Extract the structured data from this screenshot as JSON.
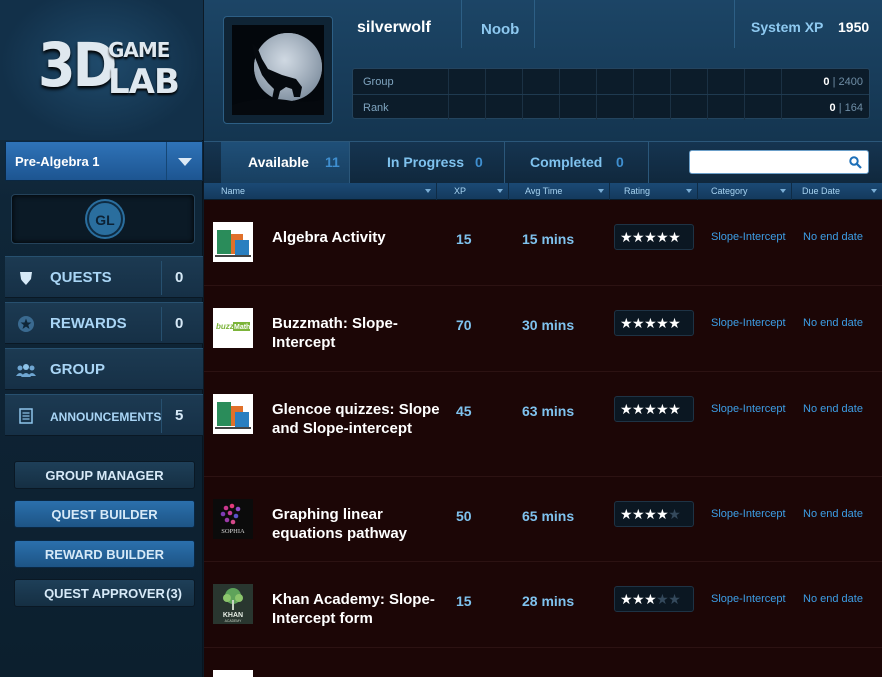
{
  "logo": {
    "big": "3D",
    "top": "GAME",
    "bottom": "LAB"
  },
  "course": {
    "selected": "Pre-Algebra 1"
  },
  "badge": {
    "initials": "GL"
  },
  "sidebar": {
    "items": [
      {
        "label": "QUESTS",
        "count": "0",
        "icon": "shield-icon"
      },
      {
        "label": "REWARDS",
        "count": "0",
        "icon": "star-badge-icon"
      },
      {
        "label": "GROUP",
        "count": "",
        "icon": "group-icon"
      },
      {
        "label": "ANNOUNCEMENTS",
        "count": "5",
        "icon": "document-icon"
      }
    ],
    "buttons": [
      {
        "label": "GROUP MANAGER",
        "badge": ""
      },
      {
        "label": "QUEST BUILDER",
        "badge": ""
      },
      {
        "label": "REWARD BUILDER",
        "badge": ""
      },
      {
        "label": "QUEST APPROVER",
        "badge": "(3)"
      }
    ]
  },
  "profile": {
    "username": "silverwolf",
    "level": "Noob",
    "system_xp_label": "System XP",
    "system_xp": "1950",
    "group_label": "Group",
    "group_value": "0",
    "group_total": "2400",
    "rank_label": "Rank",
    "rank_value": "0",
    "rank_total": "164"
  },
  "tabs": [
    {
      "label": "Available",
      "count": "11"
    },
    {
      "label": "In Progress",
      "count": "0"
    },
    {
      "label": "Completed",
      "count": "0"
    }
  ],
  "search": {
    "placeholder": "",
    "value": ""
  },
  "columns": [
    "Name",
    "XP",
    "Avg Time",
    "Rating",
    "Category",
    "Due Date"
  ],
  "quests": [
    {
      "name": "Algebra Activity",
      "xp": "15",
      "avg_time": "15 mins",
      "rating": 5,
      "category": "Slope-Intercept",
      "due": "No end date",
      "thumb": "glencoe"
    },
    {
      "name": "Buzzmath: Slope-Intercept",
      "xp": "70",
      "avg_time": "30 mins",
      "rating": 5,
      "category": "Slope-Intercept",
      "due": "No end date",
      "thumb": "buzzmath"
    },
    {
      "name": "Glencoe quizzes: Slope and Slope-intercept",
      "xp": "45",
      "avg_time": "63 mins",
      "rating": 5,
      "category": "Slope-Intercept",
      "due": "No end date",
      "thumb": "glencoe"
    },
    {
      "name": "Graphing linear equations pathway",
      "xp": "50",
      "avg_time": "65 mins",
      "rating": 4.5,
      "category": "Slope-Intercept",
      "due": "No end date",
      "thumb": "sophia"
    },
    {
      "name": "Khan Academy: Slope-Intercept form",
      "xp": "15",
      "avg_time": "28 mins",
      "rating": 3.5,
      "category": "Slope-Intercept",
      "due": "No end date",
      "thumb": "khan"
    }
  ],
  "thumb_text": {
    "buzz": "buzz",
    "math": "Math",
    "sophia": "SOPHIA",
    "khan": "KHAN",
    "academy": "ACADEMY"
  }
}
